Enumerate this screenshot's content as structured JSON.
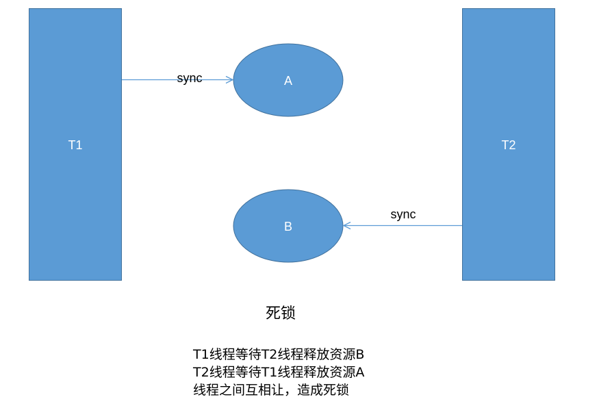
{
  "colors": {
    "fill": "#5b9bd5",
    "stroke": "#41719c",
    "arrow": "#5b9bd5",
    "shape_text": "#ffffff",
    "label_text": "#000000"
  },
  "threads": {
    "t1": "T1",
    "t2": "T2"
  },
  "resources": {
    "a": "A",
    "b": "B"
  },
  "edges": {
    "t1_to_a": "sync",
    "t2_to_b": "sync"
  },
  "caption": {
    "title": "死锁",
    "lines": [
      "T1线程等待T2线程释放资源B",
      "T2线程等待T1线程释放资源A",
      "线程之间互相让，造成死锁"
    ]
  }
}
